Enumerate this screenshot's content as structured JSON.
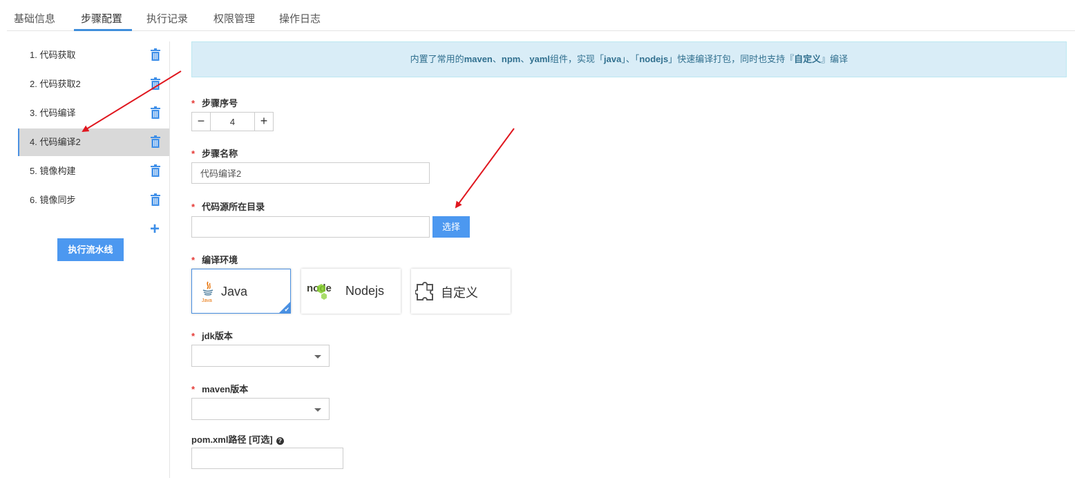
{
  "tabs": [
    "基础信息",
    "步骤配置",
    "执行记录",
    "权限管理",
    "操作日志"
  ],
  "sidebar": {
    "steps": [
      "1. 代码获取",
      "2. 代码获取2",
      "3. 代码编译",
      "4. 代码编译2",
      "5. 镜像构建",
      "6. 镜像同步"
    ],
    "active_index": 3,
    "add_symbol": "+",
    "run_button": "执行流水线"
  },
  "notice": {
    "t1": "内置了常用的",
    "b1": "maven",
    "t2": "、",
    "b2": "npm",
    "t3": "、",
    "b3": "yaml",
    "t4": "组件，实现「",
    "b4": "java",
    "t5": "」、「",
    "b5": "nodejs",
    "t6": "」快速编译打包，同时也支持『",
    "b6": "自定义",
    "t7": "』编译"
  },
  "form": {
    "required_mark": "*",
    "step_order": {
      "label": "步骤序号",
      "value": "4",
      "minus": "−",
      "plus": "+"
    },
    "step_name": {
      "label": "步骤名称",
      "value": "代码编译2"
    },
    "source_dir": {
      "label": "代码源所在目录",
      "value": "",
      "button": "选择"
    },
    "env": {
      "label": "编译环境",
      "options": [
        "Java",
        "Nodejs",
        "自定义"
      ],
      "selected": "Java",
      "java_logo_text": "Java",
      "node_logo_text": "node"
    },
    "jdk": {
      "label": "jdk版本",
      "value": ""
    },
    "maven": {
      "label": "maven版本",
      "value": ""
    },
    "pom": {
      "label": "pom.xml路径 [可选]",
      "help": "?",
      "value": ""
    }
  },
  "colors": {
    "accent": "#4c98f0",
    "required": "#e53935",
    "notice_bg": "#d9edf7",
    "arrow": "#e0171f"
  }
}
